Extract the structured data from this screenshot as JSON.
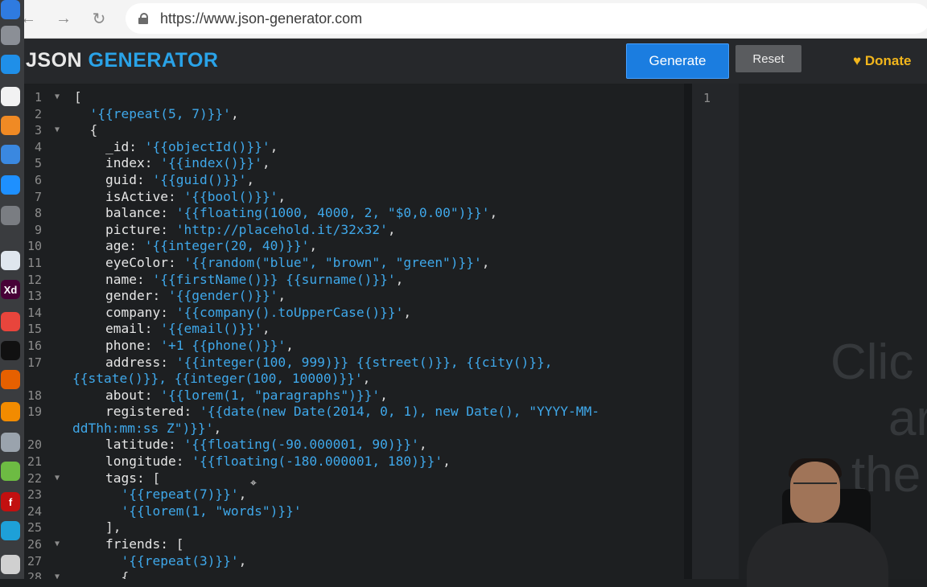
{
  "browser": {
    "url": "https://www.json-generator.com",
    "icons": [
      "back-arrow-icon",
      "forward-arrow-icon",
      "reload-icon",
      "lock-icon"
    ]
  },
  "header": {
    "logo_part1": "JSON",
    "logo_part2": "GENERATOR",
    "generate_label": "Generate",
    "reset_label": "Reset",
    "donate_label": "Donate",
    "accent_color": "#1b7de0",
    "donate_color": "#f2b61c"
  },
  "editor": {
    "lines": [
      {
        "n": "1",
        "fold": true,
        "segs": [
          [
            "p",
            "["
          ]
        ]
      },
      {
        "n": "2",
        "segs": [
          [
            "p",
            "  "
          ],
          [
            "s",
            "'{{repeat(5, 7)}}'"
          ],
          [
            "p",
            ","
          ]
        ]
      },
      {
        "n": "3",
        "fold": true,
        "segs": [
          [
            "p",
            "  {"
          ]
        ]
      },
      {
        "n": "4",
        "segs": [
          [
            "p",
            "    "
          ],
          [
            "k",
            "_id"
          ],
          [
            "p",
            ": "
          ],
          [
            "s",
            "'{{objectId()}}'"
          ],
          [
            "p",
            ","
          ]
        ]
      },
      {
        "n": "5",
        "segs": [
          [
            "p",
            "    "
          ],
          [
            "k",
            "index"
          ],
          [
            "p",
            ": "
          ],
          [
            "s",
            "'{{index()}}'"
          ],
          [
            "p",
            ","
          ]
        ]
      },
      {
        "n": "6",
        "segs": [
          [
            "p",
            "    "
          ],
          [
            "k",
            "guid"
          ],
          [
            "p",
            ": "
          ],
          [
            "s",
            "'{{guid()}}'"
          ],
          [
            "p",
            ","
          ]
        ]
      },
      {
        "n": "7",
        "segs": [
          [
            "p",
            "    "
          ],
          [
            "k",
            "isActive"
          ],
          [
            "p",
            ": "
          ],
          [
            "s",
            "'{{bool()}}'"
          ],
          [
            "p",
            ","
          ]
        ]
      },
      {
        "n": "8",
        "segs": [
          [
            "p",
            "    "
          ],
          [
            "k",
            "balance"
          ],
          [
            "p",
            ": "
          ],
          [
            "s",
            "'{{floating(1000, 4000, 2, \"$0,0.00\")}}'"
          ],
          [
            "p",
            ","
          ]
        ]
      },
      {
        "n": "9",
        "segs": [
          [
            "p",
            "    "
          ],
          [
            "k",
            "picture"
          ],
          [
            "p",
            ": "
          ],
          [
            "s",
            "'http://placehold.it/32x32'"
          ],
          [
            "p",
            ","
          ]
        ]
      },
      {
        "n": "10",
        "segs": [
          [
            "p",
            "    "
          ],
          [
            "k",
            "age"
          ],
          [
            "p",
            ": "
          ],
          [
            "s",
            "'{{integer(20, 40)}}'"
          ],
          [
            "p",
            ","
          ]
        ]
      },
      {
        "n": "11",
        "segs": [
          [
            "p",
            "    "
          ],
          [
            "k",
            "eyeColor"
          ],
          [
            "p",
            ": "
          ],
          [
            "s",
            "'{{random(\"blue\", \"brown\", \"green\")}}'"
          ],
          [
            "p",
            ","
          ]
        ]
      },
      {
        "n": "12",
        "segs": [
          [
            "p",
            "    "
          ],
          [
            "k",
            "name"
          ],
          [
            "p",
            ": "
          ],
          [
            "s",
            "'{{firstName()}} {{surname()}}'"
          ],
          [
            "p",
            ","
          ]
        ]
      },
      {
        "n": "13",
        "segs": [
          [
            "p",
            "    "
          ],
          [
            "k",
            "gender"
          ],
          [
            "p",
            ": "
          ],
          [
            "s",
            "'{{gender()}}'"
          ],
          [
            "p",
            ","
          ]
        ]
      },
      {
        "n": "14",
        "segs": [
          [
            "p",
            "    "
          ],
          [
            "k",
            "company"
          ],
          [
            "p",
            ": "
          ],
          [
            "s",
            "'{{company().toUpperCase()}}'"
          ],
          [
            "p",
            ","
          ]
        ]
      },
      {
        "n": "15",
        "segs": [
          [
            "p",
            "    "
          ],
          [
            "k",
            "email"
          ],
          [
            "p",
            ": "
          ],
          [
            "s",
            "'{{email()}}'"
          ],
          [
            "p",
            ","
          ]
        ]
      },
      {
        "n": "16",
        "segs": [
          [
            "p",
            "    "
          ],
          [
            "k",
            "phone"
          ],
          [
            "p",
            ": "
          ],
          [
            "s",
            "'+1 {{phone()}}'"
          ],
          [
            "p",
            ","
          ]
        ]
      },
      {
        "n": "17",
        "segs": [
          [
            "p",
            "    "
          ],
          [
            "k",
            "address"
          ],
          [
            "p",
            ": "
          ],
          [
            "s",
            "'{{integer(100, 999)}} {{street()}}, {{city()}},"
          ]
        ]
      },
      {
        "n": "",
        "segs": [
          [
            "s",
            "{{state()}}, {{integer(100, 10000)}}'"
          ],
          [
            "p",
            ","
          ]
        ]
      },
      {
        "n": "18",
        "segs": [
          [
            "p",
            "    "
          ],
          [
            "k",
            "about"
          ],
          [
            "p",
            ": "
          ],
          [
            "s",
            "'{{lorem(1, \"paragraphs\")}}'"
          ],
          [
            "p",
            ","
          ]
        ]
      },
      {
        "n": "19",
        "segs": [
          [
            "p",
            "    "
          ],
          [
            "k",
            "registered"
          ],
          [
            "p",
            ": "
          ],
          [
            "s",
            "'{{date(new Date(2014, 0, 1), new Date(), \"YYYY-MM-"
          ]
        ]
      },
      {
        "n": "",
        "segs": [
          [
            "s",
            "ddThh:mm:ss Z\")}}'"
          ],
          [
            "p",
            ","
          ]
        ]
      },
      {
        "n": "20",
        "segs": [
          [
            "p",
            "    "
          ],
          [
            "k",
            "latitude"
          ],
          [
            "p",
            ": "
          ],
          [
            "s",
            "'{{floating(-90.000001, 90)}}'"
          ],
          [
            "p",
            ","
          ]
        ]
      },
      {
        "n": "21",
        "segs": [
          [
            "p",
            "    "
          ],
          [
            "k",
            "longitude"
          ],
          [
            "p",
            ": "
          ],
          [
            "s",
            "'{{floating(-180.000001, 180)}}'"
          ],
          [
            "p",
            ","
          ]
        ]
      },
      {
        "n": "22",
        "fold": true,
        "segs": [
          [
            "p",
            "    "
          ],
          [
            "k",
            "tags"
          ],
          [
            "p",
            ": ["
          ]
        ]
      },
      {
        "n": "23",
        "segs": [
          [
            "p",
            "      "
          ],
          [
            "s",
            "'{{repeat(7)}}'"
          ],
          [
            "p",
            ","
          ]
        ]
      },
      {
        "n": "24",
        "segs": [
          [
            "p",
            "      "
          ],
          [
            "s",
            "'{{lorem(1, \"words\")}}'"
          ]
        ]
      },
      {
        "n": "25",
        "segs": [
          [
            "p",
            "    ],"
          ]
        ]
      },
      {
        "n": "26",
        "fold": true,
        "segs": [
          [
            "p",
            "    "
          ],
          [
            "k",
            "friends"
          ],
          [
            "p",
            ": ["
          ]
        ]
      },
      {
        "n": "27",
        "segs": [
          [
            "p",
            "      "
          ],
          [
            "s",
            "'{{repeat(3)}}'"
          ],
          [
            "p",
            ","
          ]
        ]
      },
      {
        "n": "28",
        "fold": true,
        "segs": [
          [
            "p",
            "      {"
          ]
        ]
      }
    ]
  },
  "output": {
    "line_number": "1",
    "ghost_lines": [
      "Clic",
      "ar",
      "the"
    ]
  },
  "dock": {
    "apps": [
      {
        "icon": "safari-icon",
        "color": "#2f7be0",
        "label": ""
      },
      {
        "icon": "launchpad-icon",
        "color": "#8b8f96",
        "label": ""
      },
      {
        "icon": "safari-compass-icon",
        "color": "#1f8fe8",
        "label": ""
      },
      {
        "icon": "notes-icon",
        "color": "#f2f2f2",
        "label": ""
      },
      {
        "icon": "pages-icon",
        "color": "#f08a24",
        "label": ""
      },
      {
        "icon": "keynote-icon",
        "color": "#3a88e0",
        "label": ""
      },
      {
        "icon": "app-store-icon",
        "color": "#1e90ff",
        "label": ""
      },
      {
        "icon": "system-preferences-icon",
        "color": "#7a7d82",
        "label": ""
      },
      {
        "icon": "preview-icon",
        "color": "#dfe6ee",
        "label": ""
      },
      {
        "icon": "adobe-xd-icon",
        "color": "#470137",
        "label": "Xd"
      },
      {
        "icon": "chrome-icon",
        "color": "#e8453c",
        "label": ""
      },
      {
        "icon": "terminal-icon",
        "color": "#111111",
        "label": ""
      },
      {
        "icon": "firefox-icon",
        "color": "#e66000",
        "label": ""
      },
      {
        "icon": "vlc-icon",
        "color": "#f28b00",
        "label": ""
      },
      {
        "icon": "disk-utility-icon",
        "color": "#9aa3ad",
        "label": ""
      },
      {
        "icon": "camtasia-icon",
        "color": "#6dbb43",
        "label": ""
      },
      {
        "icon": "flash-icon",
        "color": "#c21010",
        "label": "f"
      },
      {
        "icon": "browser-icon",
        "color": "#1ea0d8",
        "label": ""
      },
      {
        "icon": "finder-icon",
        "color": "#d0d0d0",
        "label": ""
      }
    ]
  }
}
